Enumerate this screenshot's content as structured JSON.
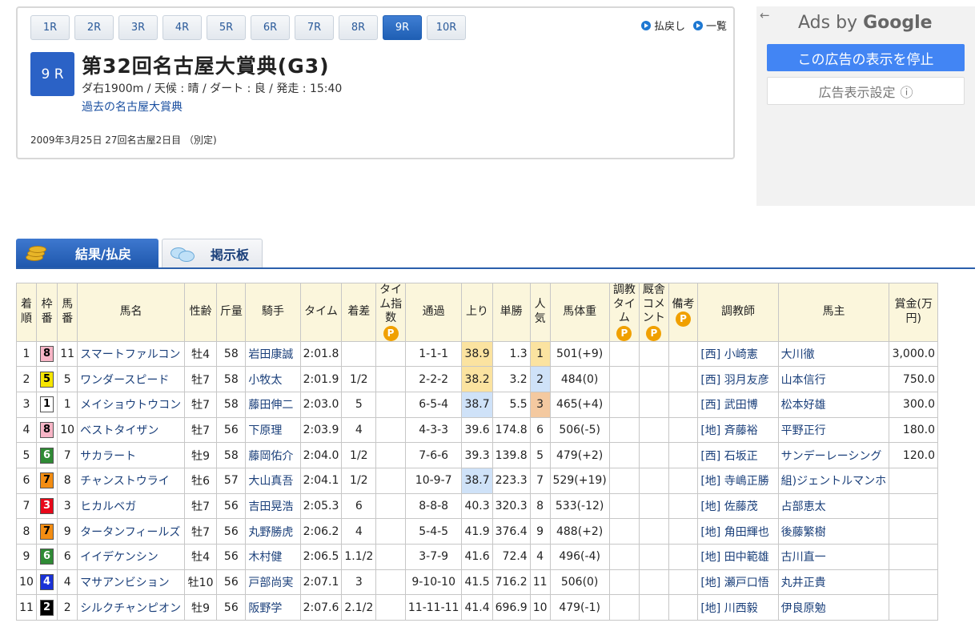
{
  "race_nav": {
    "tabs": [
      "1R",
      "2R",
      "3R",
      "4R",
      "5R",
      "6R",
      "7R",
      "8R",
      "9R",
      "10R"
    ],
    "active_index": 8,
    "links": {
      "payout": "払戻し",
      "list": "一覧"
    }
  },
  "race": {
    "number": "9 R",
    "title": "第32回名古屋大賞典(G3)",
    "conditions": "ダ右1900m / 天候 : 晴 / ダート : 良 / 発走 : 15:40",
    "past_link": "過去の名古屋大賞典",
    "date_line": "2009年3月25日 27回名古屋2日目 （別定)"
  },
  "ad": {
    "back_glyph": "←",
    "title_prefix": "Ads by ",
    "title_brand": "Google",
    "stop_button": "この広告の表示を停止",
    "settings_button": "広告表示設定",
    "settings_glyph": "ⓘ"
  },
  "content_tabs": {
    "results": "結果/払戻",
    "board": "掲示板"
  },
  "table": {
    "headers": {
      "rank": "着順",
      "frame": "枠番",
      "horse_no": "馬番",
      "horse": "馬名",
      "sex_age": "性齢",
      "weight": "斤量",
      "jockey": "騎手",
      "time": "タイム",
      "margin": "着差",
      "time_index": "タイム指数",
      "passing": "通過",
      "last3f": "上り",
      "odds": "単勝",
      "popularity": "人気",
      "body_weight": "馬体重",
      "training_time": "調教タイム",
      "stable_comment": "厩舎コメント",
      "remarks": "備考",
      "trainer": "調教師",
      "owner": "馬主",
      "prize": "賞金(万円)",
      "p_badge": "P"
    },
    "rows": [
      {
        "rank": "1",
        "frame": "8",
        "no": "11",
        "horse": "スマートファルコン",
        "sex_age": "牡4",
        "weight": "58",
        "jockey": "岩田康誠",
        "time": "2:01.8",
        "margin": "",
        "passing": "1-1-1",
        "last3f": "38.9",
        "odds": "1.3",
        "pop": "1",
        "bw": "501(+9)",
        "trainer": "[西] 小崎憲",
        "owner": "大川徹",
        "prize": "3,000.0"
      },
      {
        "rank": "2",
        "frame": "5",
        "no": "5",
        "horse": "ワンダースピード",
        "sex_age": "牡7",
        "weight": "58",
        "jockey": "小牧太",
        "time": "2:01.9",
        "margin": "1/2",
        "passing": "2-2-2",
        "last3f": "38.2",
        "odds": "3.2",
        "pop": "2",
        "bw": "484(0)",
        "trainer": "[西] 羽月友彦",
        "owner": "山本信行",
        "prize": "750.0"
      },
      {
        "rank": "3",
        "frame": "1",
        "no": "1",
        "horse": "メイショウトウコン",
        "sex_age": "牡7",
        "weight": "58",
        "jockey": "藤田伸二",
        "time": "2:03.0",
        "margin": "5",
        "passing": "6-5-4",
        "last3f": "38.7",
        "odds": "5.5",
        "pop": "3",
        "bw": "465(+4)",
        "trainer": "[西] 武田博",
        "owner": "松本好雄",
        "prize": "300.0"
      },
      {
        "rank": "4",
        "frame": "8",
        "no": "10",
        "horse": "ベストタイザン",
        "sex_age": "牡7",
        "weight": "56",
        "jockey": "下原理",
        "time": "2:03.9",
        "margin": "4",
        "passing": "4-3-3",
        "last3f": "39.6",
        "odds": "174.8",
        "pop": "6",
        "bw": "506(-5)",
        "trainer": "[地] 斉藤裕",
        "owner": "平野正行",
        "prize": "180.0"
      },
      {
        "rank": "5",
        "frame": "6",
        "no": "7",
        "horse": "サカラート",
        "sex_age": "牡9",
        "weight": "58",
        "jockey": "藤岡佑介",
        "time": "2:04.0",
        "margin": "1/2",
        "passing": "7-6-6",
        "last3f": "39.3",
        "odds": "139.8",
        "pop": "5",
        "bw": "479(+2)",
        "trainer": "[西] 石坂正",
        "owner": "サンデーレーシング",
        "prize": "120.0"
      },
      {
        "rank": "6",
        "frame": "7",
        "no": "8",
        "horse": "チャンストウライ",
        "sex_age": "牡6",
        "weight": "57",
        "jockey": "大山真吾",
        "time": "2:04.1",
        "margin": "1/2",
        "passing": "10-9-7",
        "last3f": "38.7",
        "odds": "223.3",
        "pop": "7",
        "bw": "529(+19)",
        "trainer": "[地] 寺嶋正勝",
        "owner": "組)ジェントルマンホ",
        "prize": ""
      },
      {
        "rank": "7",
        "frame": "3",
        "no": "3",
        "horse": "ヒカルベガ",
        "sex_age": "牡7",
        "weight": "56",
        "jockey": "吉田晃浩",
        "time": "2:05.3",
        "margin": "6",
        "passing": "8-8-8",
        "last3f": "40.3",
        "odds": "320.3",
        "pop": "8",
        "bw": "533(-12)",
        "trainer": "[地] 佐藤茂",
        "owner": "占部恵太",
        "prize": ""
      },
      {
        "rank": "8",
        "frame": "7",
        "no": "9",
        "horse": "タータンフィールズ",
        "sex_age": "牡7",
        "weight": "56",
        "jockey": "丸野勝虎",
        "time": "2:06.2",
        "margin": "4",
        "passing": "5-4-5",
        "last3f": "41.9",
        "odds": "376.4",
        "pop": "9",
        "bw": "488(+2)",
        "trainer": "[地] 角田輝也",
        "owner": "後藤繁樹",
        "prize": ""
      },
      {
        "rank": "9",
        "frame": "6",
        "no": "6",
        "horse": "イイデケンシン",
        "sex_age": "牡4",
        "weight": "56",
        "jockey": "木村健",
        "time": "2:06.5",
        "margin": "1.1/2",
        "passing": "3-7-9",
        "last3f": "41.6",
        "odds": "72.4",
        "pop": "4",
        "bw": "496(-4)",
        "trainer": "[地] 田中範雄",
        "owner": "古川直一",
        "prize": ""
      },
      {
        "rank": "10",
        "frame": "4",
        "no": "4",
        "horse": "マサアンビション",
        "sex_age": "牡10",
        "weight": "56",
        "jockey": "戸部尚実",
        "time": "2:07.1",
        "margin": "3",
        "passing": "9-10-10",
        "last3f": "41.5",
        "odds": "716.2",
        "pop": "11",
        "bw": "506(0)",
        "trainer": "[地] 瀬戸口悟",
        "owner": "丸井正貴",
        "prize": ""
      },
      {
        "rank": "11",
        "frame": "2",
        "no": "2",
        "horse": "シルクチャンピオン",
        "sex_age": "牡9",
        "weight": "56",
        "jockey": "阪野学",
        "time": "2:07.6",
        "margin": "2.1/2",
        "passing": "11-11-11",
        "last3f": "41.4",
        "odds": "696.9",
        "pop": "10",
        "bw": "479(-1)",
        "trainer": "[地] 川西毅",
        "owner": "伊良原勉",
        "prize": ""
      }
    ]
  },
  "colors": {
    "frame": {
      "1": "#ffffff",
      "2": "#000000",
      "3": "#e8081a",
      "4": "#1a32d6",
      "5": "#f6e600",
      "6": "#2f8a35",
      "7": "#f38d12",
      "8": "#f7b5c6"
    },
    "frame_text": {
      "1": "#000000",
      "2": "#ffffff",
      "3": "#ffffff",
      "4": "#ffffff",
      "5": "#000000",
      "6": "#ffffff",
      "7": "#000000",
      "8": "#000000"
    },
    "accent": "#2b62c6",
    "header_bg": "#fbf6dc"
  }
}
